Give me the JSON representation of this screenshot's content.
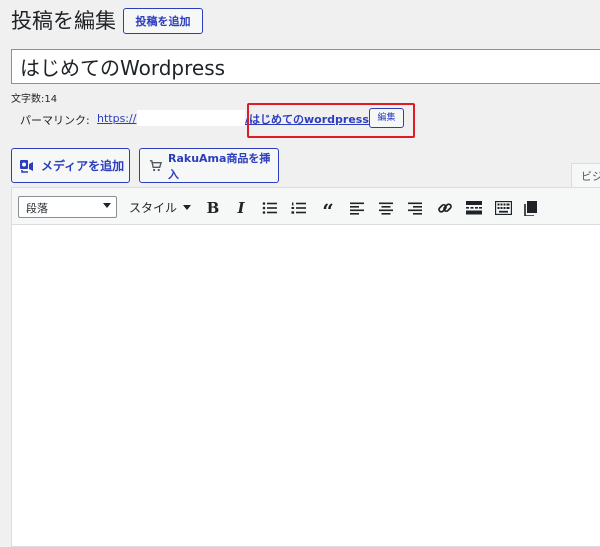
{
  "header": {
    "title": "投稿を編集",
    "add_new_label": "投稿を追加"
  },
  "post": {
    "title_value": "はじめてのWordpress",
    "word_count": "文字数:14"
  },
  "permalink": {
    "label": "パーマリンク:",
    "prefix": "https://",
    "slug": "/はじめてのwordpress/",
    "edit_label": "編集"
  },
  "media_buttons": {
    "add_media": "メディアを追加",
    "rakuama": "RakuAma商品を挿入"
  },
  "editor": {
    "visual_tab": "ビジ",
    "format_select": "段落",
    "style_menu": "スタイル",
    "toolbar_icons": [
      "bold-icon",
      "italic-icon",
      "bullet-list-icon",
      "numbered-list-icon",
      "blockquote-icon",
      "align-left-icon",
      "align-center-icon",
      "align-right-icon",
      "link-icon",
      "read-more-icon",
      "toolbar-toggle-icon",
      "paste-icon"
    ],
    "content": ""
  },
  "colors": {
    "accent": "#2c3dbd",
    "highlight": "#e01b24",
    "background": "#f0f0f1"
  }
}
